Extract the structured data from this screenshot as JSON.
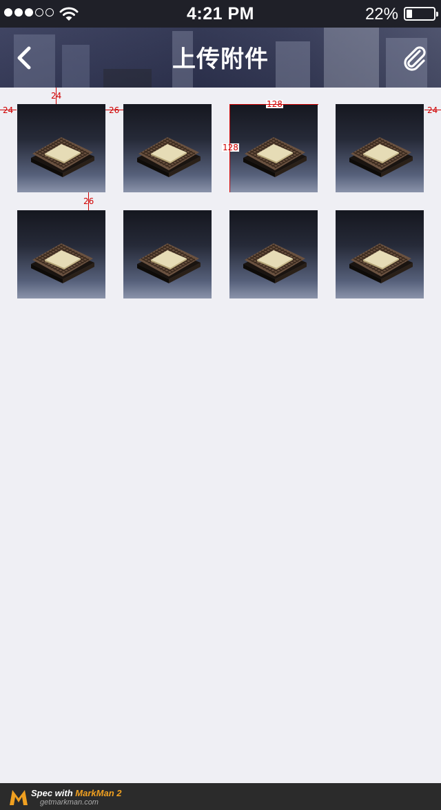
{
  "status_bar": {
    "time": "4:21 PM",
    "battery_percent": "22%",
    "battery_level": 0.22,
    "signal_bars_filled": 3,
    "signal_bars_total": 5,
    "icons": [
      "signal-dots-icon",
      "wifi-icon",
      "battery-icon"
    ]
  },
  "nav": {
    "title": "上传附件",
    "back_icon": "chevron-left-icon",
    "attach_icon": "paperclip-icon"
  },
  "attachments": {
    "count": 8,
    "items": [
      {
        "name": "cpu-chip-image"
      },
      {
        "name": "cpu-chip-image"
      },
      {
        "name": "cpu-chip-image"
      },
      {
        "name": "cpu-chip-image"
      },
      {
        "name": "cpu-chip-image"
      },
      {
        "name": "cpu-chip-image"
      },
      {
        "name": "cpu-chip-image"
      },
      {
        "name": "cpu-chip-image"
      }
    ]
  },
  "spec_annotations": {
    "top_margin": "24",
    "left_margin": "24",
    "right_margin": "24",
    "column_gap": "26",
    "row_gap": "26",
    "thumb_width": "128",
    "thumb_height": "128"
  },
  "footer": {
    "brand_prefix": "Spec with ",
    "brand_name": "MarkMan 2",
    "url": "getmarkman.com"
  },
  "colors": {
    "page_background": "#efeff4",
    "status_bar": "#1f2028",
    "nav_bar": "#2e3350",
    "spec_red": "#d00000",
    "footer": "#2b2b2b",
    "brand_accent": "#f0a020"
  }
}
